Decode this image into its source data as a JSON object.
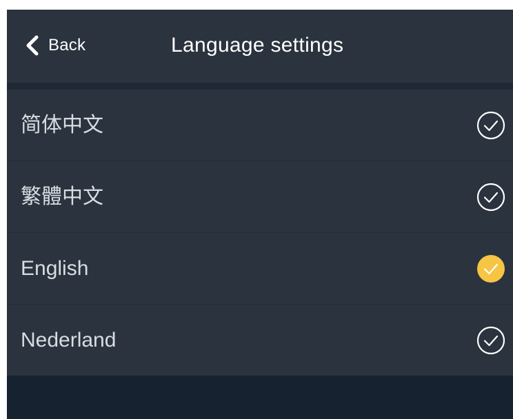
{
  "header": {
    "back_label": "Back",
    "title": "Language settings"
  },
  "languages": [
    {
      "label": "简体中文",
      "selected": false
    },
    {
      "label": "繁體中文",
      "selected": false
    },
    {
      "label": "English",
      "selected": true
    },
    {
      "label": "Nederland",
      "selected": false
    }
  ],
  "colors": {
    "selected_check": "#f6c544",
    "unselected_check": "#ffffff"
  }
}
